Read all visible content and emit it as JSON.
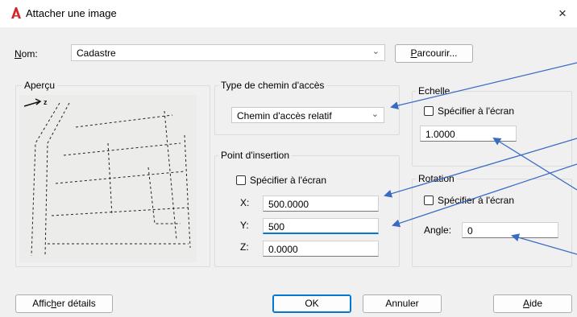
{
  "window": {
    "title": "Attacher une image",
    "close": "×"
  },
  "nom": {
    "label": "Nom:",
    "value": "Cadastre",
    "browse_button": "Parcourir..."
  },
  "apercu": {
    "title": "Aperçu"
  },
  "path_type": {
    "title": "Type de chemin d'accès",
    "selected": "Chemin d'accès relatif"
  },
  "insertion": {
    "title": "Point d'insertion",
    "specify_label": "Spécifier à l'écran",
    "x_label": "X:",
    "x_value": "500.0000",
    "y_label": "Y:",
    "y_value": "500",
    "z_label": "Z:",
    "z_value": "0.0000"
  },
  "scale": {
    "title": "Echelle",
    "specify_label": "Spécifier à l'écran",
    "value": "1.0000"
  },
  "rotation": {
    "title": "Rotation",
    "specify_label": "Spécifier à l'écran",
    "angle_label": "Angle:",
    "angle_value": "0"
  },
  "buttons": {
    "details": "Afficher détails",
    "ok": "OK",
    "cancel": "Annuler",
    "help": "Aide"
  },
  "colors": {
    "accent": "#0078d4",
    "annotation": "#3a6bc4",
    "app_icon": "#d8232a"
  },
  "icons": {
    "app": "autocad-a-icon",
    "dropdown": "chevron-down-icon",
    "close": "close-icon"
  }
}
